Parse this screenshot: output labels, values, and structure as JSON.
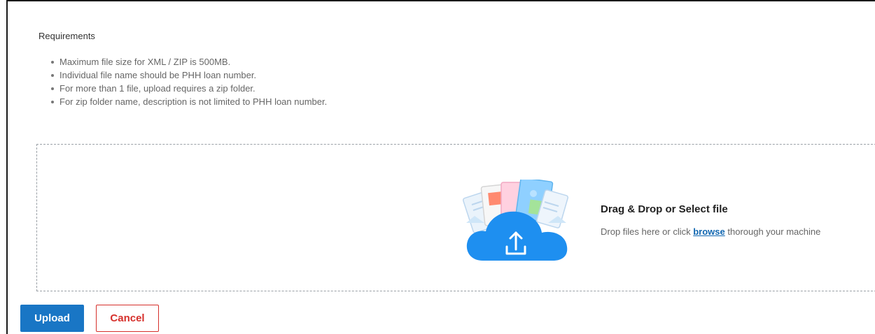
{
  "requirements": {
    "title": "Requirements",
    "items": [
      "Maximum file size for XML / ZIP is 500MB.",
      "Individual file name should be PHH loan number.",
      "For more than 1 file, upload requires a zip folder.",
      "For zip folder name, description is not limited to PHH loan number."
    ]
  },
  "dropzone": {
    "icon": "cloud-upload-icon",
    "title": "Drag & Drop or Select file",
    "subtitle_before": "Drop files here or click",
    "browse_link": "browse",
    "subtitle_after": "thorough your machine"
  },
  "actions": {
    "upload_label": "Upload",
    "cancel_label": "Cancel"
  },
  "colors": {
    "primary": "#1976c5",
    "danger": "#d6302b",
    "link": "#1167b1",
    "cloud": "#1e8ff0"
  }
}
